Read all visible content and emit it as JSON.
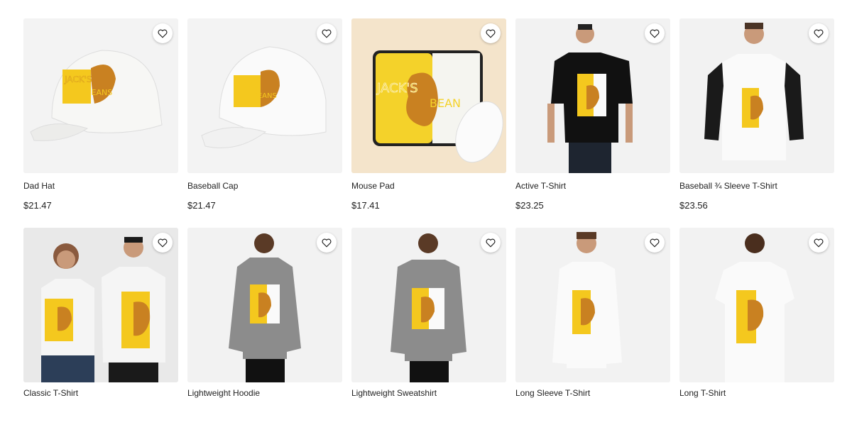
{
  "favorite_icon": "heart-outline-icon",
  "colors": {
    "accent_yellow": "#f4c81e",
    "bean_brown": "#c98121",
    "bg_gray": "#f2f2f2"
  },
  "products_row1": [
    {
      "name": "Dad Hat",
      "price": "$21.47"
    },
    {
      "name": "Baseball Cap",
      "price": "$21.47"
    },
    {
      "name": "Mouse Pad",
      "price": "$17.41"
    },
    {
      "name": "Active T-Shirt",
      "price": "$23.25"
    },
    {
      "name": "Baseball ¾ Sleeve T-Shirt",
      "price": "$23.56"
    }
  ],
  "products_row2": [
    {
      "name": "Classic T-Shirt"
    },
    {
      "name": "Lightweight Hoodie"
    },
    {
      "name": "Lightweight Sweatshirt"
    },
    {
      "name": "Long Sleeve T-Shirt"
    },
    {
      "name": "Long T-Shirt"
    }
  ],
  "design_text": {
    "line1": "JACK'S",
    "line2": "BEANS"
  }
}
